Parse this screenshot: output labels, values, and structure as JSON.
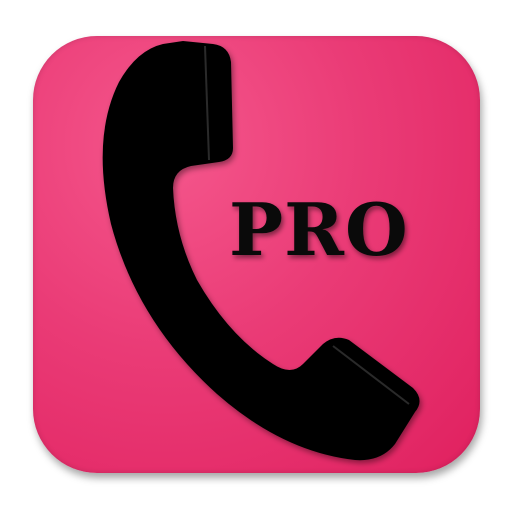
{
  "icon": {
    "name": "phone-icon",
    "badge_text": "PRO",
    "background_color": "#ea3b76",
    "glyph_color": "#000000"
  }
}
